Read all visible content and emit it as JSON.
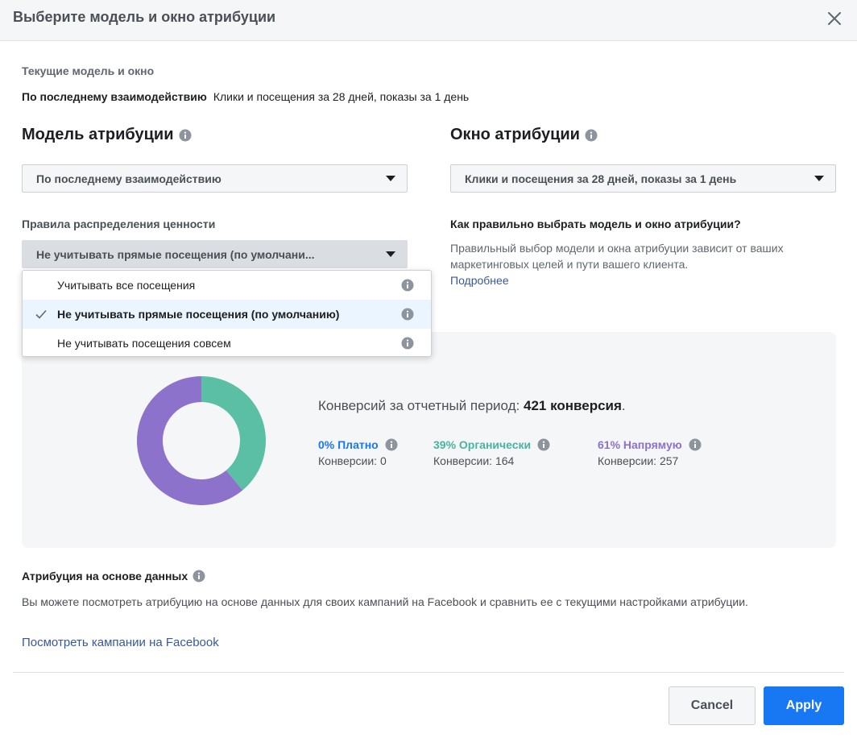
{
  "dialog": {
    "title": "Выберите модель и окно атрибуции"
  },
  "current": {
    "label": "Текущие модель и окно",
    "model": "По последнему взаимодействию",
    "window": "Клики и посещения за 28 дней, показы за 1 день"
  },
  "model": {
    "heading": "Модель атрибуции",
    "selected": "По последнему взаимодействию"
  },
  "window": {
    "heading": "Окно атрибуции",
    "selected": "Клики и посещения за 28 дней, показы за 1 день"
  },
  "rules": {
    "label": "Правила распределения ценности",
    "selected": "Не учитывать прямые посещения (по умолчани...",
    "options": [
      {
        "label": "Учитывать все посещения",
        "selected": false
      },
      {
        "label": "Не учитывать прямые посещения (по умолчанию)",
        "selected": true
      },
      {
        "label": "Не учитывать посещения совсем",
        "selected": false
      }
    ]
  },
  "help": {
    "title": "Как правильно выбрать модель и окно атрибуции?",
    "text": "Правильный выбор модели и окна атрибуции зависит от ваших маркетинговых целей и пути вашего клиента.",
    "link": "Подробнее"
  },
  "summary": {
    "prefix": "Конверсий за отчетный период:",
    "total": "421 конверсия",
    "suffix": ".",
    "stats": [
      {
        "name": "0% Платно",
        "value": "Конверсии: 0",
        "color": "#1877f2"
      },
      {
        "name": "39% Органически",
        "value": "Конверсии: 164",
        "color": "#4ab3a0"
      },
      {
        "name": "61% Напрямую",
        "value": "Конверсии: 257",
        "color": "#8c72cb"
      }
    ]
  },
  "chart_data": {
    "type": "pie",
    "categories": [
      "Платно",
      "Органически",
      "Напрямую"
    ],
    "values": [
      0,
      164,
      257
    ],
    "colors": [
      "#1877f2",
      "#5bbfa5",
      "#8c72cb"
    ]
  },
  "data_driven": {
    "title": "Атрибуция на основе данных",
    "text": "Вы можете посмотреть атрибуцию на основе данных для своих кампаний на Facebook и сравнить ее с текущими настройками атрибуции.",
    "link": "Посмотреть кампании на Facebook"
  },
  "footer": {
    "cancel": "Cancel",
    "apply": "Apply"
  },
  "colors": {
    "accent": "#1877f2",
    "link": "#385898"
  }
}
